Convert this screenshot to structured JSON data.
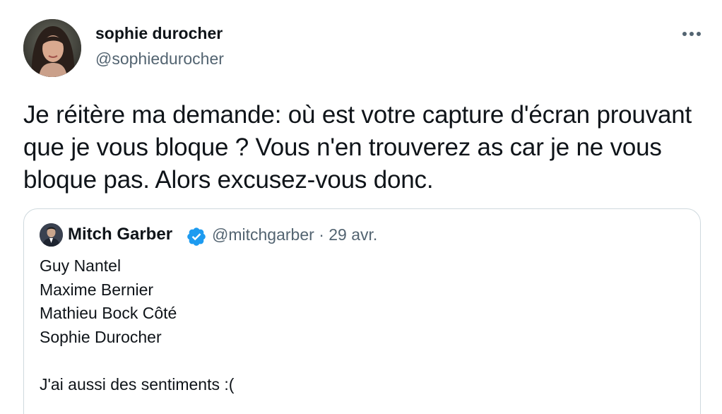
{
  "tweet": {
    "author": {
      "name": "sophie durocher",
      "handle": "@sophiedurocher"
    },
    "text": "Je réitère ma demande: où est votre capture d'écran prouvant que je vous bloque ? Vous n'en trouverez as car je ne vous bloque pas. Alors excusez-vous donc.",
    "more_icon": "more-horizontal-icon"
  },
  "quoted_tweet": {
    "author": {
      "name": "Mitch Garber",
      "handle": "@mitchgarber",
      "verified_icon": "verified-badge-icon"
    },
    "separator": "·",
    "date": "29 avr.",
    "lines": [
      "Guy Nantel",
      "Maxime Bernier",
      "Mathieu Bock Côté",
      "Sophie Durocher",
      "",
      "J'ai aussi des sentiments :("
    ]
  },
  "colors": {
    "text_primary": "#0f1419",
    "text_secondary": "#536471",
    "border": "#cfd9de",
    "verified_blue": "#1d9bf0"
  }
}
